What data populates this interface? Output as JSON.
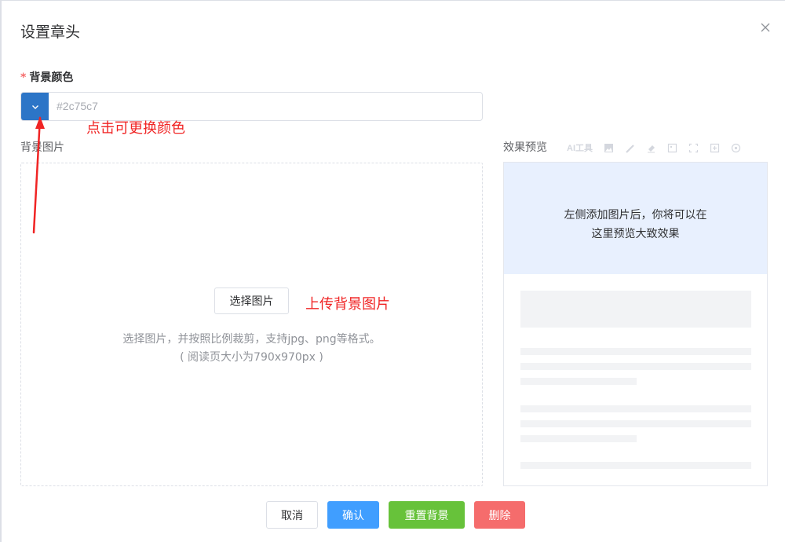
{
  "dialog": {
    "title": "设置章头"
  },
  "background_color": {
    "label": "背景颜色",
    "required_mark": "*",
    "value": "#2c75c7",
    "swatch_color": "#2c75c7"
  },
  "background_image": {
    "label": "背景图片",
    "select_button": "选择图片",
    "hint_line1": "选择图片，并按照比例裁剪，支持jpg、png等格式。",
    "hint_line2": "( 阅读页大小为790x970px )"
  },
  "preview": {
    "label": "效果预览",
    "toolbar_ai": "AI工具",
    "message_line1": "左侧添加图片后，你将可以在",
    "message_line2": "这里预览大致效果"
  },
  "annotations": {
    "color_hint": "点击可更换颜色",
    "upload_hint": "上传背景图片",
    "color": "#f02424"
  },
  "footer": {
    "cancel": "取消",
    "confirm": "确认",
    "reset_background": "重置背景",
    "delete": "删除"
  },
  "colors": {
    "primary": "#409eff",
    "success": "#67c23a",
    "danger": "#f56c6c",
    "preview_bg": "#e8f0fe"
  },
  "icons": [
    "close-icon",
    "chevron-down-icon",
    "image-icon",
    "brush-icon",
    "eraser-icon",
    "picture-icon",
    "crop-icon",
    "add-icon",
    "settings-icon",
    "arrow-annotation"
  ]
}
